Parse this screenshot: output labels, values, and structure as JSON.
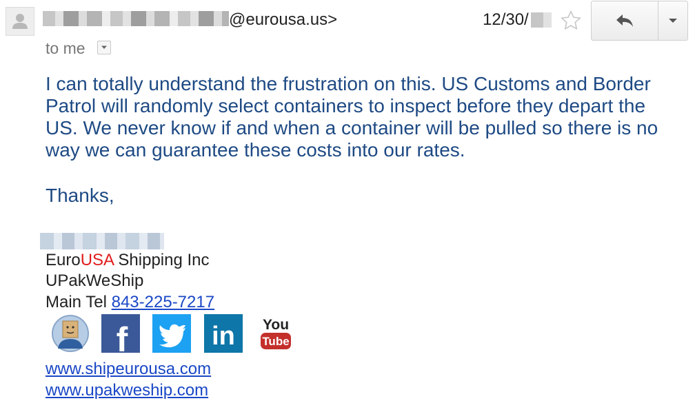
{
  "header": {
    "sender_address": "@eurousa.us>",
    "date": "12/30/",
    "recipient_label": "to me"
  },
  "icons": {
    "avatar": "person-icon",
    "star": "star-icon",
    "reply": "reply-icon",
    "more": "chevron-down-icon",
    "details": "chevron-down-icon"
  },
  "message": {
    "paragraph": "I can totally understand the frustration on this. US Customs and Border Patrol will randomly select containers to inspect before they depart the US. We never know if and when a container will be pulled so there is no way we can guarantee these costs into our rates.",
    "closing": "Thanks,"
  },
  "signature": {
    "company_prefix": "Euro",
    "company_highlight": "USA",
    "company_suffix": " Shipping Inc",
    "brand": "UPakWeShip",
    "tel_label": "Main Tel ",
    "tel_number": "843-225-7217"
  },
  "social": {
    "facebook_glyph": "f",
    "linkedin_glyph": "in",
    "youtube_top": "You",
    "youtube_bottom": "Tube"
  },
  "links": [
    "www.shipeurousa.com",
    "www.upakweship.com"
  ],
  "colors": {
    "body_text": "#1e4a84",
    "link": "#1a47c6",
    "brand_red": "#e11b1b",
    "facebook": "#3b5998",
    "twitter": "#1da1f2",
    "linkedin": "#0e76a8",
    "youtube": "#c4302b"
  }
}
